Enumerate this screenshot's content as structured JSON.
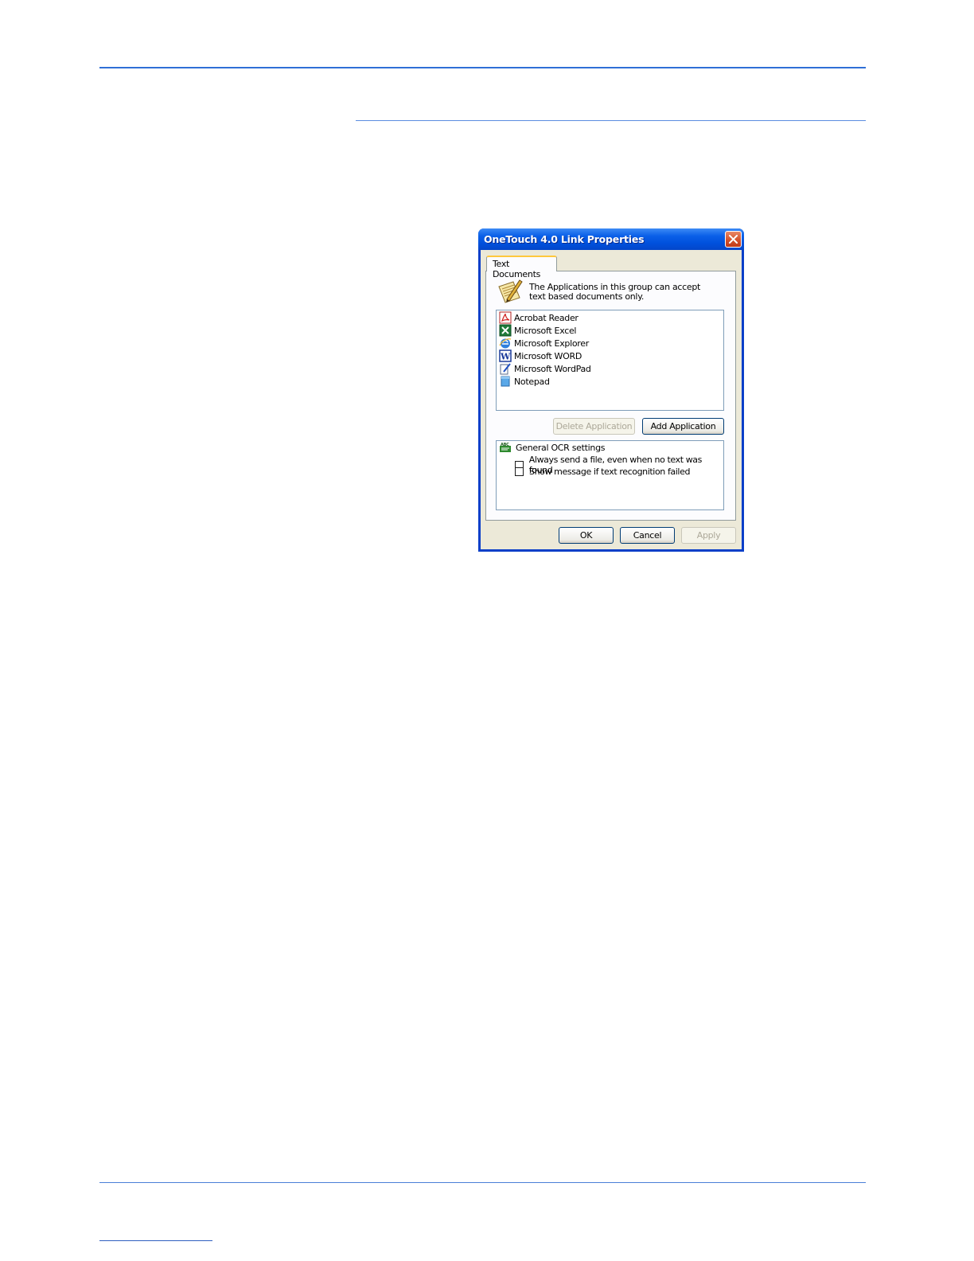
{
  "dialog": {
    "title": "OneTouch 4.0 Link Properties",
    "tab_label": "Text Documents",
    "info_text": "The Applications in this group can accept text based documents only.",
    "applications": [
      {
        "label": "Acrobat Reader",
        "icon": "acrobat-icon"
      },
      {
        "label": "Microsoft Excel",
        "icon": "excel-icon"
      },
      {
        "label": "Microsoft Explorer",
        "icon": "internet-explorer-icon"
      },
      {
        "label": "Microsoft WORD",
        "icon": "word-icon"
      },
      {
        "label": "Microsoft WordPad",
        "icon": "wordpad-icon"
      },
      {
        "label": "Notepad",
        "icon": "notepad-icon"
      }
    ],
    "delete_button": "Delete Application",
    "add_button": "Add Application",
    "ocr": {
      "heading": "General OCR settings",
      "options": [
        {
          "label": "Always send a file, even when no text was found",
          "checked": false
        },
        {
          "label": "Show message if text recognition failed",
          "checked": false
        }
      ]
    },
    "ok_button": "OK",
    "cancel_button": "Cancel",
    "apply_button": "Apply"
  }
}
